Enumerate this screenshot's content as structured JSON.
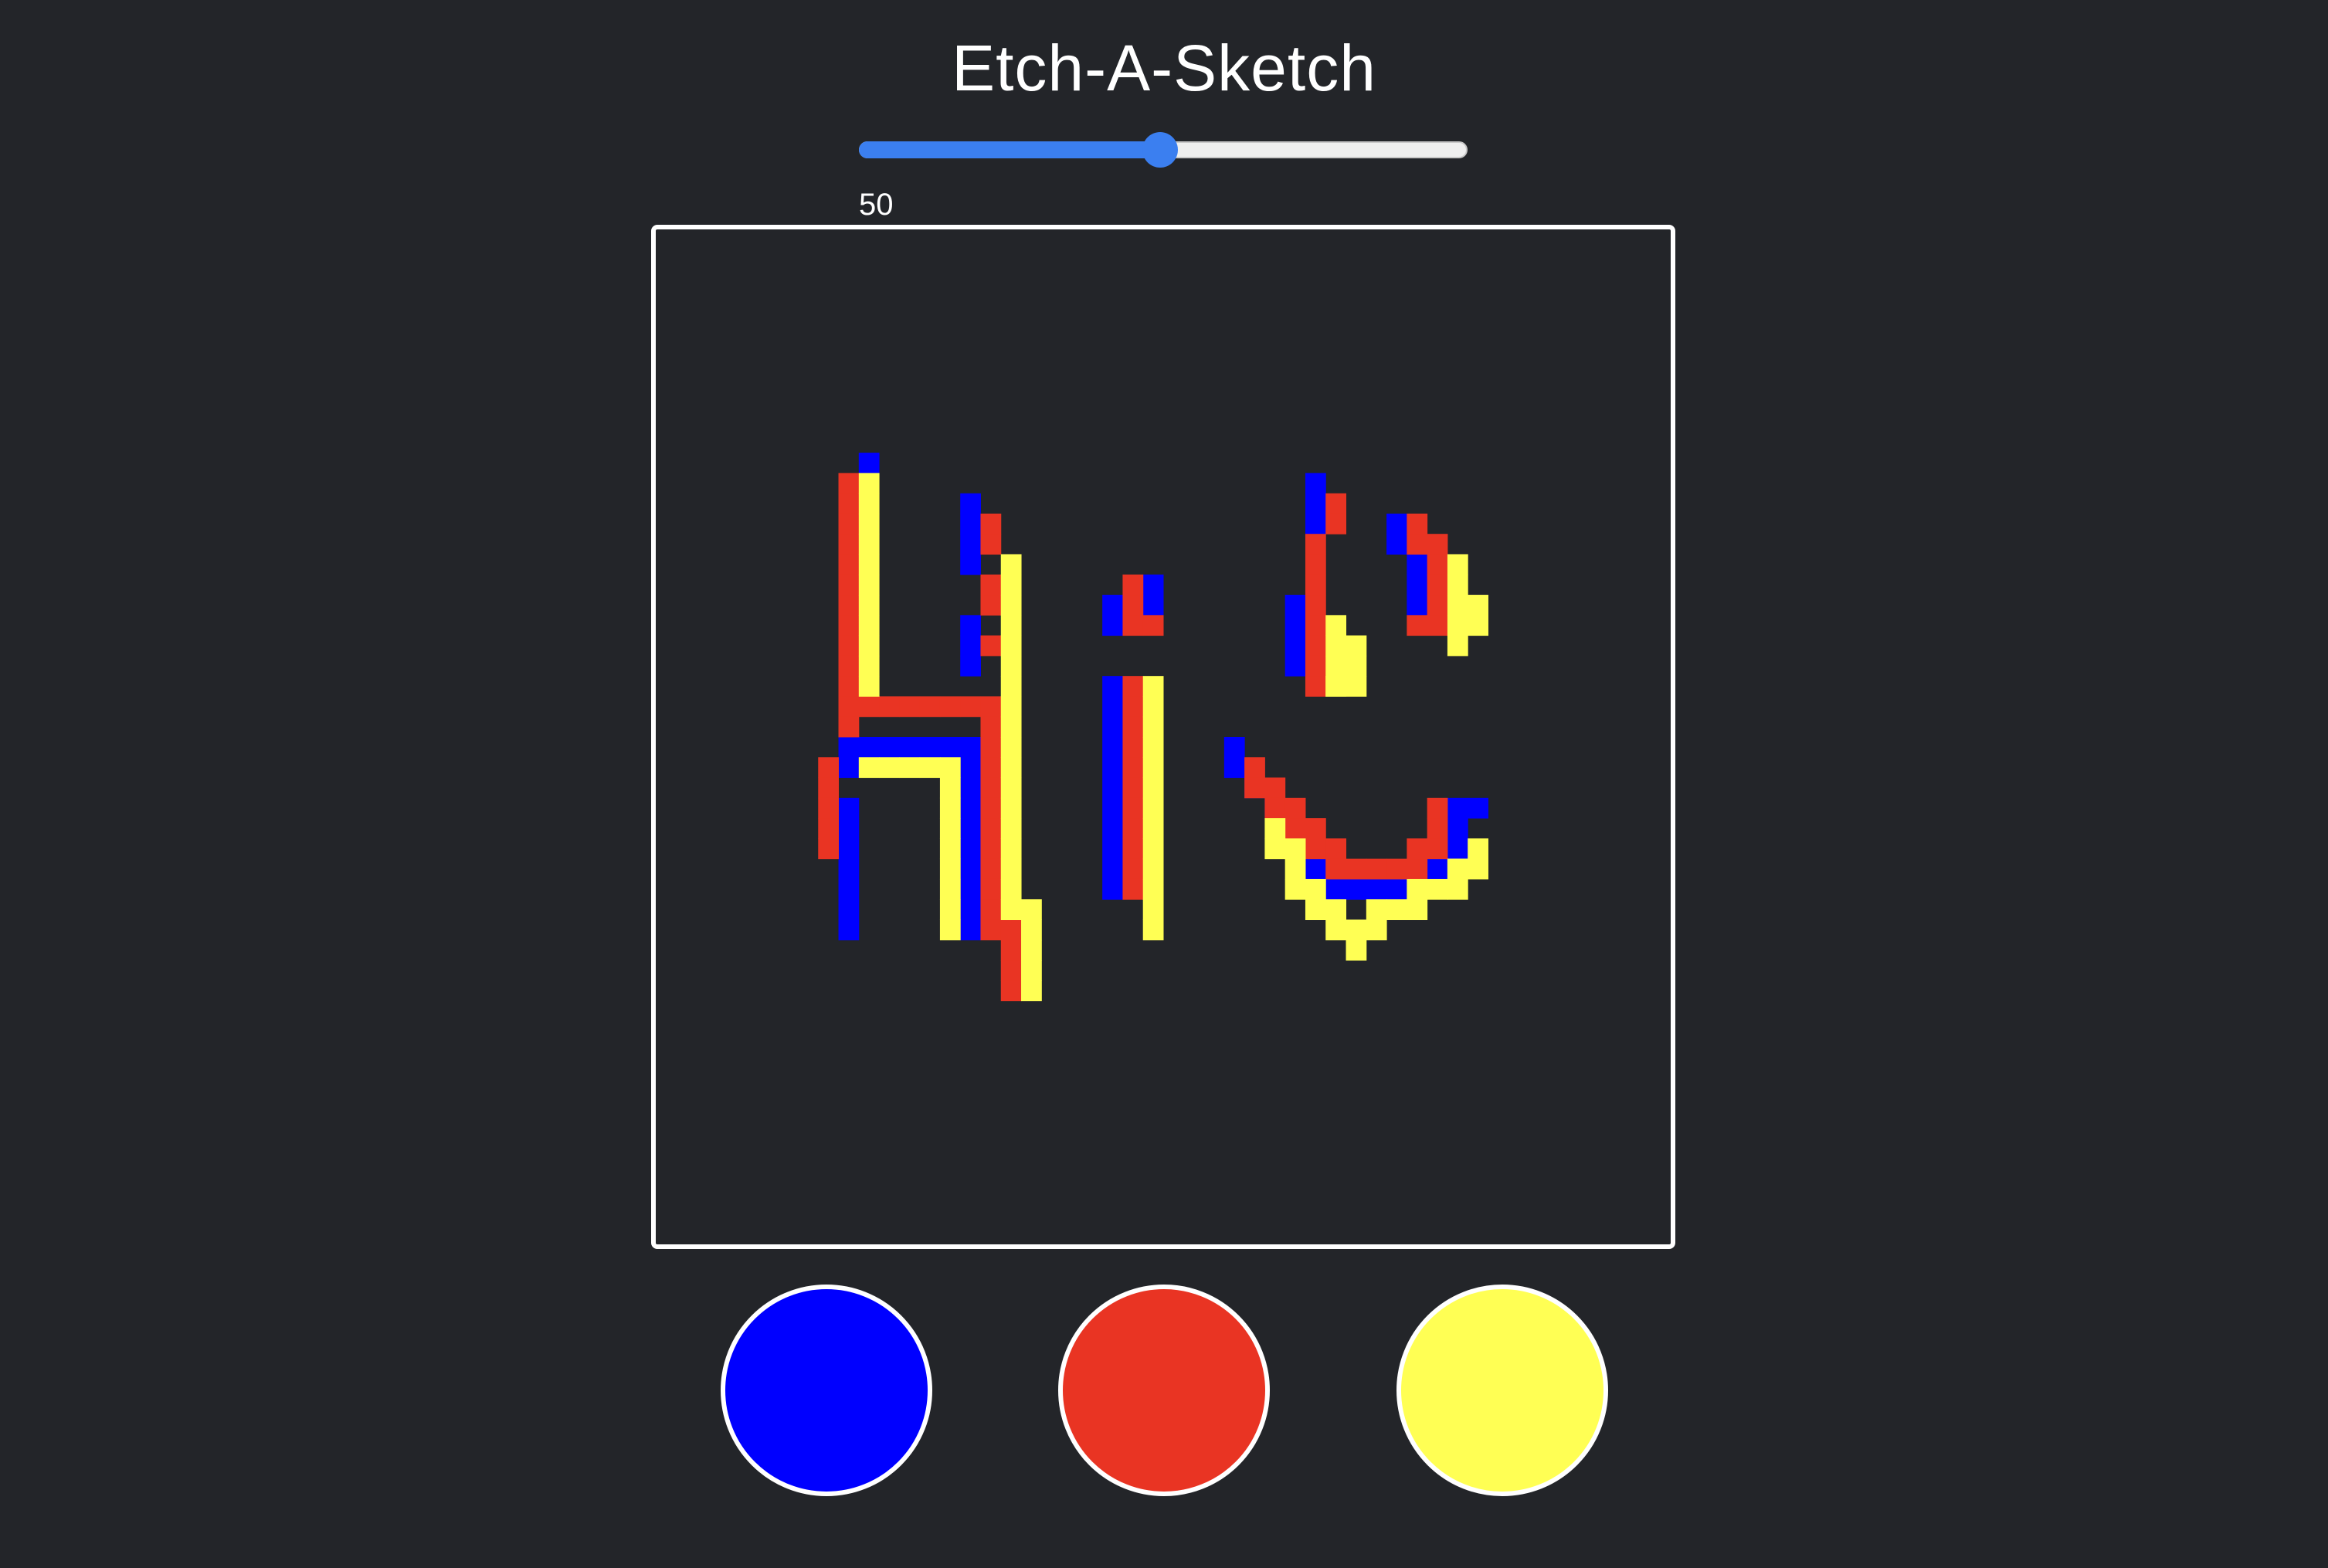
{
  "app": {
    "title": "Etch-A-Sketch"
  },
  "grid_size": {
    "value": 50,
    "label": "50",
    "min": 1,
    "max": 100
  },
  "palette": [
    {
      "name": "blue",
      "color": "#0000ff"
    },
    {
      "name": "red",
      "color": "#e93423"
    },
    {
      "name": "yellow",
      "color": "#ffff54"
    }
  ],
  "board": {
    "background": "#232529",
    "border_color": "#ffffff"
  },
  "drawing": {
    "blue": [
      [
        10,
        11
      ],
      [
        15,
        13
      ],
      [
        15,
        14
      ],
      [
        15,
        15
      ],
      [
        15,
        16
      ],
      [
        15,
        19
      ],
      [
        15,
        20
      ],
      [
        15,
        21
      ],
      [
        9,
        25
      ],
      [
        10,
        25
      ],
      [
        11,
        25
      ],
      [
        12,
        25
      ],
      [
        13,
        25
      ],
      [
        14,
        25
      ],
      [
        15,
        25
      ],
      [
        15,
        26
      ],
      [
        9,
        26
      ],
      [
        15,
        27
      ],
      [
        15,
        28
      ],
      [
        15,
        29
      ],
      [
        15,
        30
      ],
      [
        15,
        31
      ],
      [
        15,
        32
      ],
      [
        15,
        33
      ],
      [
        15,
        34
      ],
      [
        9,
        28
      ],
      [
        9,
        29
      ],
      [
        9,
        30
      ],
      [
        9,
        31
      ],
      [
        9,
        32
      ],
      [
        9,
        33
      ],
      [
        9,
        34
      ],
      [
        22,
        18
      ],
      [
        22,
        19
      ],
      [
        24,
        17
      ],
      [
        24,
        18
      ],
      [
        22,
        22
      ],
      [
        22,
        23
      ],
      [
        22,
        24
      ],
      [
        22,
        25
      ],
      [
        22,
        26
      ],
      [
        22,
        27
      ],
      [
        22,
        28
      ],
      [
        22,
        29
      ],
      [
        22,
        30
      ],
      [
        22,
        31
      ],
      [
        22,
        32
      ],
      [
        32,
        12
      ],
      [
        32,
        13
      ],
      [
        32,
        14
      ],
      [
        31,
        18
      ],
      [
        31,
        19
      ],
      [
        31,
        20
      ],
      [
        31,
        21
      ],
      [
        36,
        14
      ],
      [
        36,
        15
      ],
      [
        37,
        16
      ],
      [
        37,
        17
      ],
      [
        37,
        18
      ],
      [
        28,
        25
      ],
      [
        28,
        26
      ],
      [
        29,
        27
      ],
      [
        30,
        28
      ],
      [
        31,
        29
      ],
      [
        32,
        31
      ],
      [
        33,
        32
      ],
      [
        34,
        32
      ],
      [
        35,
        32
      ],
      [
        36,
        32
      ],
      [
        38,
        31
      ],
      [
        39,
        28
      ],
      [
        39,
        29
      ],
      [
        39,
        30
      ],
      [
        40,
        28
      ]
    ],
    "red": [
      [
        9,
        12
      ],
      [
        9,
        13
      ],
      [
        9,
        14
      ],
      [
        9,
        15
      ],
      [
        9,
        16
      ],
      [
        9,
        17
      ],
      [
        9,
        18
      ],
      [
        9,
        19
      ],
      [
        9,
        20
      ],
      [
        9,
        21
      ],
      [
        9,
        22
      ],
      [
        9,
        23
      ],
      [
        9,
        24
      ],
      [
        10,
        23
      ],
      [
        11,
        23
      ],
      [
        12,
        23
      ],
      [
        13,
        23
      ],
      [
        14,
        23
      ],
      [
        15,
        23
      ],
      [
        16,
        23
      ],
      [
        16,
        24
      ],
      [
        16,
        25
      ],
      [
        16,
        26
      ],
      [
        16,
        27
      ],
      [
        16,
        28
      ],
      [
        16,
        29
      ],
      [
        16,
        30
      ],
      [
        16,
        31
      ],
      [
        16,
        32
      ],
      [
        16,
        33
      ],
      [
        16,
        34
      ],
      [
        17,
        34
      ],
      [
        17,
        35
      ],
      [
        17,
        36
      ],
      [
        17,
        37
      ],
      [
        16,
        14
      ],
      [
        16,
        15
      ],
      [
        16,
        17
      ],
      [
        16,
        18
      ],
      [
        16,
        20
      ],
      [
        8,
        26
      ],
      [
        8,
        27
      ],
      [
        8,
        28
      ],
      [
        8,
        29
      ],
      [
        8,
        30
      ],
      [
        23,
        17
      ],
      [
        23,
        18
      ],
      [
        23,
        19
      ],
      [
        24,
        19
      ],
      [
        23,
        22
      ],
      [
        23,
        23
      ],
      [
        23,
        24
      ],
      [
        23,
        25
      ],
      [
        23,
        26
      ],
      [
        23,
        27
      ],
      [
        23,
        28
      ],
      [
        23,
        29
      ],
      [
        23,
        30
      ],
      [
        23,
        31
      ],
      [
        23,
        32
      ],
      [
        33,
        13
      ],
      [
        33,
        14
      ],
      [
        32,
        15
      ],
      [
        32,
        16
      ],
      [
        32,
        17
      ],
      [
        32,
        18
      ],
      [
        32,
        19
      ],
      [
        32,
        20
      ],
      [
        32,
        21
      ],
      [
        32,
        22
      ],
      [
        37,
        14
      ],
      [
        37,
        15
      ],
      [
        37,
        19
      ],
      [
        38,
        15
      ],
      [
        38,
        16
      ],
      [
        38,
        17
      ],
      [
        38,
        18
      ],
      [
        38,
        19
      ],
      [
        29,
        26
      ],
      [
        29,
        27
      ],
      [
        30,
        27
      ],
      [
        30,
        28
      ],
      [
        31,
        28
      ],
      [
        31,
        29
      ],
      [
        32,
        29
      ],
      [
        32,
        30
      ],
      [
        33,
        30
      ],
      [
        33,
        31
      ],
      [
        34,
        31
      ],
      [
        35,
        31
      ],
      [
        36,
        31
      ],
      [
        37,
        31
      ],
      [
        37,
        30
      ],
      [
        38,
        30
      ],
      [
        38,
        28
      ],
      [
        38,
        29
      ]
    ],
    "yellow": [
      [
        10,
        12
      ],
      [
        10,
        13
      ],
      [
        10,
        14
      ],
      [
        10,
        15
      ],
      [
        10,
        16
      ],
      [
        10,
        17
      ],
      [
        10,
        18
      ],
      [
        10,
        19
      ],
      [
        10,
        20
      ],
      [
        10,
        21
      ],
      [
        10,
        22
      ],
      [
        10,
        26
      ],
      [
        11,
        26
      ],
      [
        12,
        26
      ],
      [
        13,
        26
      ],
      [
        14,
        26
      ],
      [
        14,
        27
      ],
      [
        14,
        28
      ],
      [
        14,
        29
      ],
      [
        14,
        30
      ],
      [
        14,
        31
      ],
      [
        14,
        32
      ],
      [
        14,
        33
      ],
      [
        14,
        34
      ],
      [
        17,
        16
      ],
      [
        17,
        17
      ],
      [
        17,
        18
      ],
      [
        17,
        19
      ],
      [
        17,
        20
      ],
      [
        17,
        21
      ],
      [
        17,
        22
      ],
      [
        17,
        23
      ],
      [
        17,
        24
      ],
      [
        17,
        25
      ],
      [
        17,
        26
      ],
      [
        17,
        27
      ],
      [
        17,
        28
      ],
      [
        17,
        29
      ],
      [
        17,
        30
      ],
      [
        17,
        31
      ],
      [
        17,
        32
      ],
      [
        17,
        33
      ],
      [
        18,
        33
      ],
      [
        18,
        34
      ],
      [
        18,
        35
      ],
      [
        18,
        36
      ],
      [
        18,
        37
      ],
      [
        24,
        22
      ],
      [
        24,
        23
      ],
      [
        24,
        24
      ],
      [
        24,
        25
      ],
      [
        24,
        26
      ],
      [
        24,
        27
      ],
      [
        24,
        28
      ],
      [
        24,
        29
      ],
      [
        24,
        30
      ],
      [
        24,
        31
      ],
      [
        24,
        32
      ],
      [
        24,
        33
      ],
      [
        24,
        34
      ],
      [
        33,
        19
      ],
      [
        33,
        20
      ],
      [
        33,
        21
      ],
      [
        33,
        22
      ],
      [
        34,
        20
      ],
      [
        34,
        21
      ],
      [
        34,
        22
      ],
      [
        33,
        22
      ],
      [
        39,
        16
      ],
      [
        39,
        17
      ],
      [
        39,
        18
      ],
      [
        39,
        19
      ],
      [
        40,
        18
      ],
      [
        40,
        19
      ],
      [
        39,
        20
      ],
      [
        30,
        29
      ],
      [
        30,
        30
      ],
      [
        31,
        30
      ],
      [
        31,
        31
      ],
      [
        31,
        32
      ],
      [
        32,
        32
      ],
      [
        32,
        33
      ],
      [
        33,
        33
      ],
      [
        33,
        34
      ],
      [
        34,
        34
      ],
      [
        34,
        35
      ],
      [
        35,
        34
      ],
      [
        35,
        33
      ],
      [
        36,
        33
      ],
      [
        37,
        33
      ],
      [
        37,
        32
      ],
      [
        38,
        32
      ],
      [
        39,
        31
      ],
      [
        39,
        31
      ],
      [
        40,
        30
      ],
      [
        40,
        31
      ],
      [
        39,
        32
      ]
    ]
  }
}
